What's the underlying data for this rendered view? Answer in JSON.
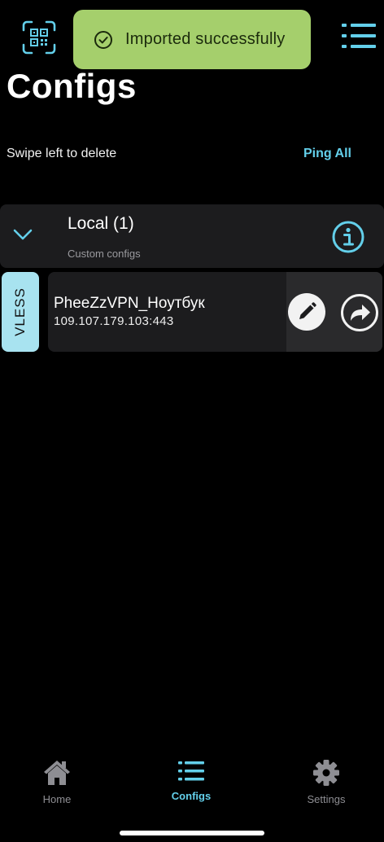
{
  "colors": {
    "accent": "#63cfea",
    "toast_bg": "#a5cf6c",
    "card_bg": "#1c1c1e",
    "tag_bg": "#a8e3f0"
  },
  "toolbar": {
    "left_icon": "qr-scan-icon",
    "right_icon": "menu-list-icon"
  },
  "toast": {
    "icon": "check-circle-icon",
    "message": "Imported successfully"
  },
  "page": {
    "title": "Configs",
    "hint": "Swipe left to delete",
    "ping_all_label": "Ping All"
  },
  "group": {
    "title": "Local (1)",
    "subtitle": "Custom configs",
    "expand_icon": "chevron-down-icon",
    "info_icon": "info-icon"
  },
  "configs": [
    {
      "protocol": "VLESS",
      "name": "PheeZzVPN_Ноутбук",
      "address": "109.107.179.103:443",
      "edit_icon": "pencil-icon",
      "share_icon": "share-arrow-icon"
    }
  ],
  "bottom_nav": [
    {
      "label": "Home",
      "icon": "house-icon",
      "active": false
    },
    {
      "label": "Configs",
      "icon": "list-icon",
      "active": true
    },
    {
      "label": "Settings",
      "icon": "gear-icon",
      "active": false
    }
  ]
}
